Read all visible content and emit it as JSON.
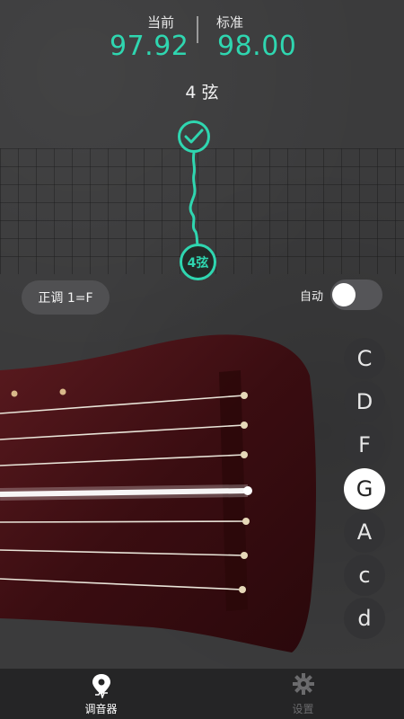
{
  "header": {
    "current_label": "当前",
    "current_value": "97.92",
    "standard_label": "标准",
    "standard_value": "98.00"
  },
  "string_name": "4 弦",
  "string_badge": "4弦",
  "tuning_mode": "正调 1=F",
  "auto": {
    "label": "自动",
    "enabled": false
  },
  "notes": [
    {
      "label": "C",
      "selected": false
    },
    {
      "label": "D",
      "selected": false
    },
    {
      "label": "F",
      "selected": false
    },
    {
      "label": "G",
      "selected": true
    },
    {
      "label": "A",
      "selected": false
    },
    {
      "label": "c",
      "selected": false
    },
    {
      "label": "d",
      "selected": false
    }
  ],
  "tabs": [
    {
      "label": "调音器",
      "icon": "tuner-pin-icon",
      "active": true
    },
    {
      "label": "设置",
      "icon": "gear-icon",
      "active": false
    }
  ],
  "colors": {
    "accent": "#2fd6b0",
    "background": "#3b3b3c",
    "tabbar": "#252526",
    "wood": "#3a0e12"
  }
}
